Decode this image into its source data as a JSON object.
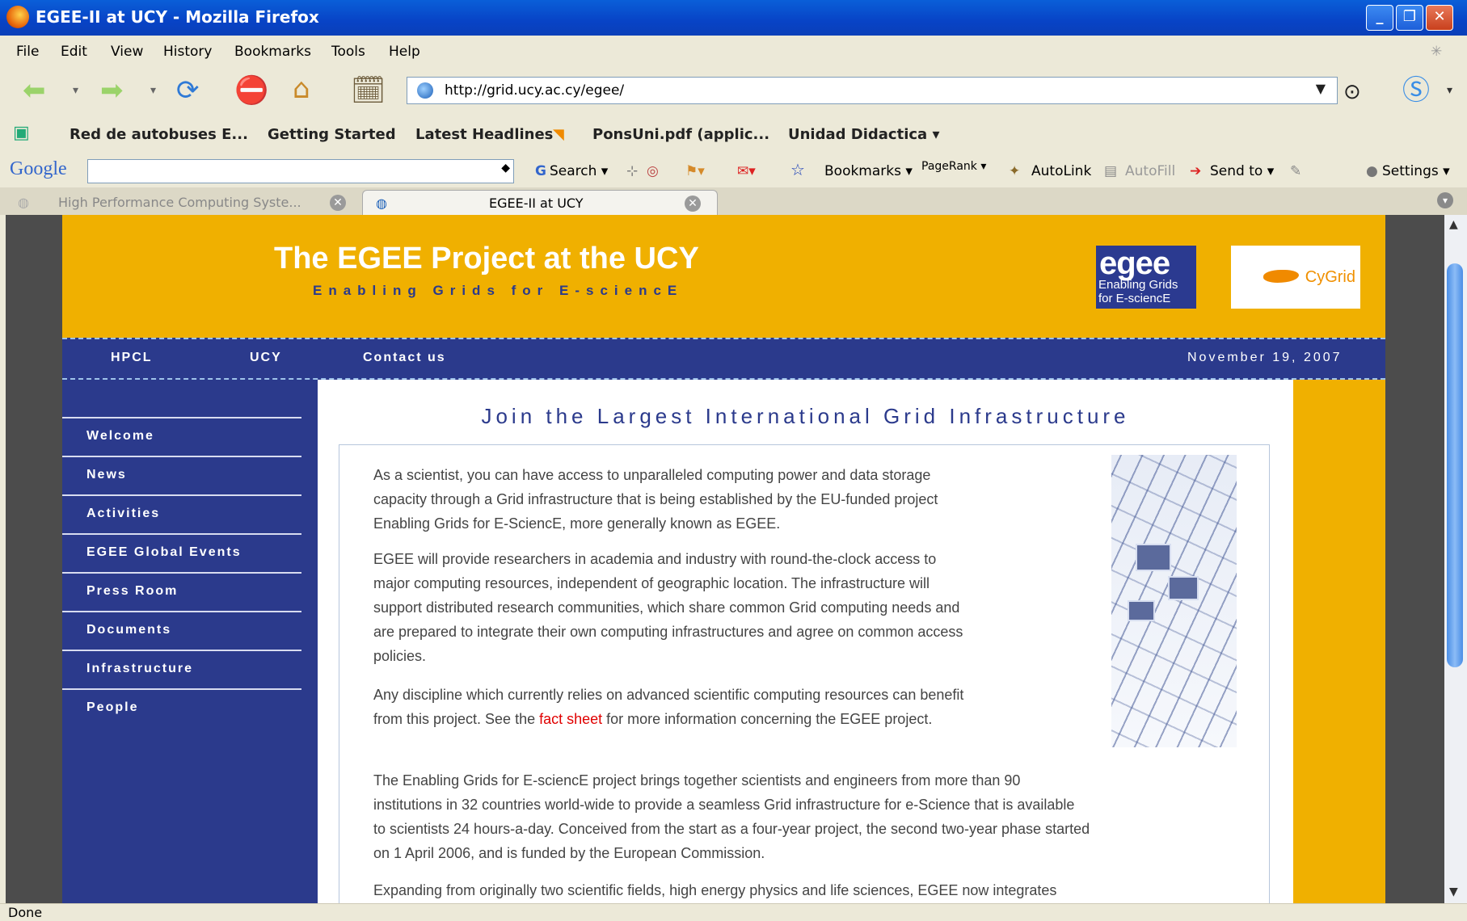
{
  "window": {
    "title": "EGEE-II at UCY - Mozilla Firefox"
  },
  "menu": [
    "File",
    "Edit",
    "View",
    "History",
    "Bookmarks",
    "Tools",
    "Help"
  ],
  "address": {
    "url": "http://grid.ucy.ac.cy/egee/"
  },
  "bookmarks": {
    "items": [
      "Red de autobuses E...",
      "Getting Started",
      "Latest Headlines",
      "PonsUni.pdf (applic...",
      "Unidad Didactica ▾"
    ]
  },
  "google_toolbar": {
    "brand": "Google",
    "search": "Search ▾",
    "bookmarks": "Bookmarks ▾",
    "pagerank": "PageRank ▾",
    "autolink": "AutoLink",
    "autofill": "AutoFill",
    "sendto": "Send to ▾",
    "settings": "Settings ▾"
  },
  "tabs": [
    {
      "label": "High Performance Computing Syste..."
    },
    {
      "label": "EGEE-II at UCY"
    }
  ],
  "page": {
    "title": "The EGEE Project at the UCY",
    "subtitle": "Enabling Grids for E-sciencE",
    "logo_egee": {
      "big": "egee",
      "line1": "Enabling Grids",
      "line2": "for E-sciencE"
    },
    "logo_cygrid": "CyGrid",
    "topnav": [
      "HPCL",
      "UCY",
      "Contact us"
    ],
    "date": "November 19, 2007",
    "sidebar": [
      "Welcome",
      "News",
      "Activities",
      "EGEE Global Events",
      "Press Room",
      "Documents",
      "Infrastructure",
      "People"
    ],
    "heading": "Join the Largest International Grid Infrastructure",
    "p1": [
      "As a scientist, you can have access to unparalleled computing power and data storage",
      "capacity through a Grid infrastructure that is being established by the EU-funded project",
      "Enabling Grids for E-SciencE, more generally known as EGEE."
    ],
    "p2": [
      "EGEE will provide researchers in academia and industry with round-the-clock access to",
      "major computing resources, independent of geographic location. The infrastructure will",
      "support distributed research communities, which share common Grid computing needs and",
      "are prepared to integrate their own computing infrastructures and agree on common access",
      "policies."
    ],
    "p3_line1": "Any discipline which currently relies on advanced scientific computing resources can benefit",
    "p3_pre": "from this project. See the ",
    "p3_link": "fact sheet",
    "p3_post": " for more information concerning the EGEE project.",
    "p4": [
      "The Enabling Grids for E-sciencE project brings together scientists and engineers from more than 90",
      "institutions in 32 countries world-wide to provide a seamless Grid infrastructure for e-Science that is available",
      "to scientists 24 hours-a-day. Conceived from the start as a four-year project, the second two-year phase started",
      "on 1 April 2006, and is funded by the European Commission."
    ],
    "p5": "Expanding from originally two scientific fields, high energy physics and life sciences, EGEE now integrates"
  },
  "status": "Done",
  "colors": {
    "header": "#f0b000",
    "navy": "#2b3a8c",
    "link": "#e00000"
  }
}
